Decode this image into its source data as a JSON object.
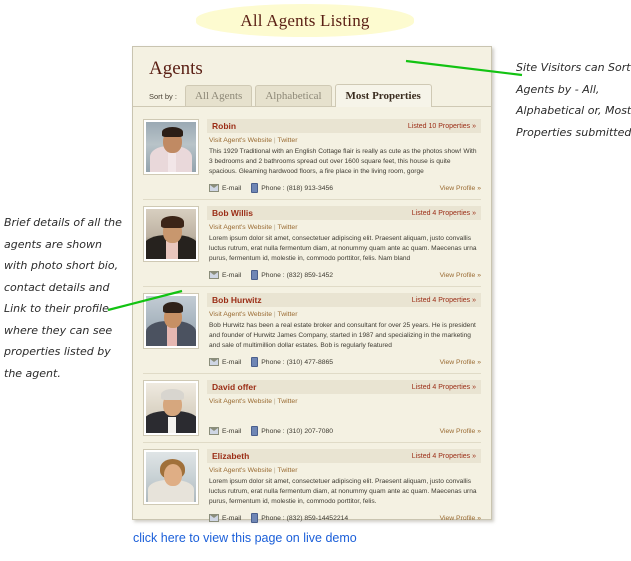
{
  "banner": {
    "title": "All Agents Listing"
  },
  "panel": {
    "heading": "Agents",
    "sort_label": "Sort by :",
    "tabs": [
      {
        "label": "All Agents",
        "active": false
      },
      {
        "label": "Alphabetical",
        "active": false
      },
      {
        "label": "Most Properties",
        "active": true
      }
    ]
  },
  "agents": [
    {
      "name": "Robin",
      "listed": "Listed 10 Properties »",
      "website_link": "Visit Agent's Website",
      "twitter_link": "Twitter",
      "bio": "This 1929 Traditional with an English Cottage flair is really as cute as the photos show! With 3 bedrooms and 2 bathrooms spread out over 1600 square feet, this house is quite spacious. Gleaming hardwood floors, a fire place in the living room, gorge",
      "email_label": "E-mail",
      "phone": "Phone : (818) 913-3456",
      "view_profile": "View Profile »"
    },
    {
      "name": "Bob Willis",
      "listed": "Listed 4 Properties »",
      "website_link": "Visit Agent's Website",
      "twitter_link": "Twitter",
      "bio": "Lorem ipsum dolor sit amet, consectetuer adipiscing elit. Praesent aliquam, justo convallis luctus rutrum, erat nulla fermentum diam, at nonummy quam ante ac quam. Maecenas urna purus, fermentum id, molestie in, commodo porttitor, felis. Nam bland",
      "email_label": "E-mail",
      "phone": "Phone : (832) 859-1452",
      "view_profile": "View Profile »"
    },
    {
      "name": "Bob Hurwitz",
      "listed": "Listed 4 Properties »",
      "website_link": "Visit Agent's Website",
      "twitter_link": "Twitter",
      "bio": "Bob Hurwitz has been a real estate broker and consultant for over 25 years. He is president and founder of Hurwitz James Company, started in 1987 and specializing in the marketing and sale of multimillion dollar estates. Bob is regularly featured",
      "email_label": "E-mail",
      "phone": "Phone : (310) 477-8865",
      "view_profile": "View Profile »"
    },
    {
      "name": "David offer",
      "listed": "Listed 4 Properties »",
      "website_link": "Visit Agent's Website",
      "twitter_link": "Twitter",
      "bio": "",
      "email_label": "E-mail",
      "phone": "Phone : (310) 207-7080",
      "view_profile": "View Profile »"
    },
    {
      "name": "Elizabeth",
      "listed": "Listed 4 Properties »",
      "website_link": "Visit Agent's Website",
      "twitter_link": "Twitter",
      "bio": "Lorem ipsum dolor sit amet, consectetuer adipiscing elit. Praesent aliquam, justo convallis luctus rutrum, erat nulla fermentum diam, at nonummy quam ante ac quam. Maecenas urna purus, fermentum id, molestie in, commodo porttitor, felis.",
      "email_label": "E-mail",
      "phone": "Phone : (832) 859-14452214",
      "view_profile": "View Profile »"
    }
  ],
  "demo_link": {
    "label": "click here to view  this page on live demo"
  },
  "annotations": {
    "right": "Site Visitors can Sort Agents by - All, Alphabetical or, Most Properties submitted",
    "left": "Brief details of all the agents are shown with photo short bio, contact details and Link to their profile where they can see properties listed by the agent."
  },
  "colors": {
    "panel_bg": "#f4f1e2",
    "banner_bg": "#fdfbd0",
    "heading": "#5a1f14",
    "agent_name": "#9b2d16",
    "link": "#9a6b32",
    "arrow": "#12c312",
    "demo_link": "#1b5fd9"
  }
}
